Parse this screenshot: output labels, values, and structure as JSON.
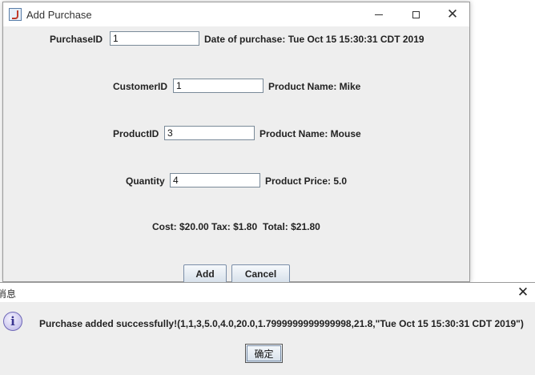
{
  "window": {
    "title": "Add Purchase",
    "icon": "java-cup-icon",
    "controls": [
      "minimize-icon",
      "maximize-icon",
      "close-icon"
    ],
    "close_glyph": "✕"
  },
  "form": {
    "purchase_id": {
      "label": "PurchaseID",
      "value": "1"
    },
    "date_text": "Date of purchase: Tue Oct 15 15:30:31 CDT 2019",
    "customer_id": {
      "label": "CustomerID",
      "value": "1"
    },
    "customer_info": "Product Name: Mike",
    "product_id": {
      "label": "ProductID",
      "value": "3"
    },
    "product_info": "Product Name: Mouse",
    "quantity": {
      "label": "Quantity",
      "value": "4"
    },
    "price_info": "Product Price: 5.0",
    "cost": "Cost: $20.00",
    "tax": "Tax: $1.80",
    "total": "Total: $21.80"
  },
  "buttons": {
    "add": "Add",
    "cancel": "Cancel"
  },
  "dialog": {
    "title": "消息",
    "close_glyph": "✕",
    "icon": "info-icon",
    "icon_glyph": "i",
    "message": "Purchase added successfully!(1,1,3,5.0,4.0,20.0,1.7999999999999998,21.8,\"Tue Oct 15 15:30:31 CDT 2019\")",
    "ok": "确定"
  }
}
